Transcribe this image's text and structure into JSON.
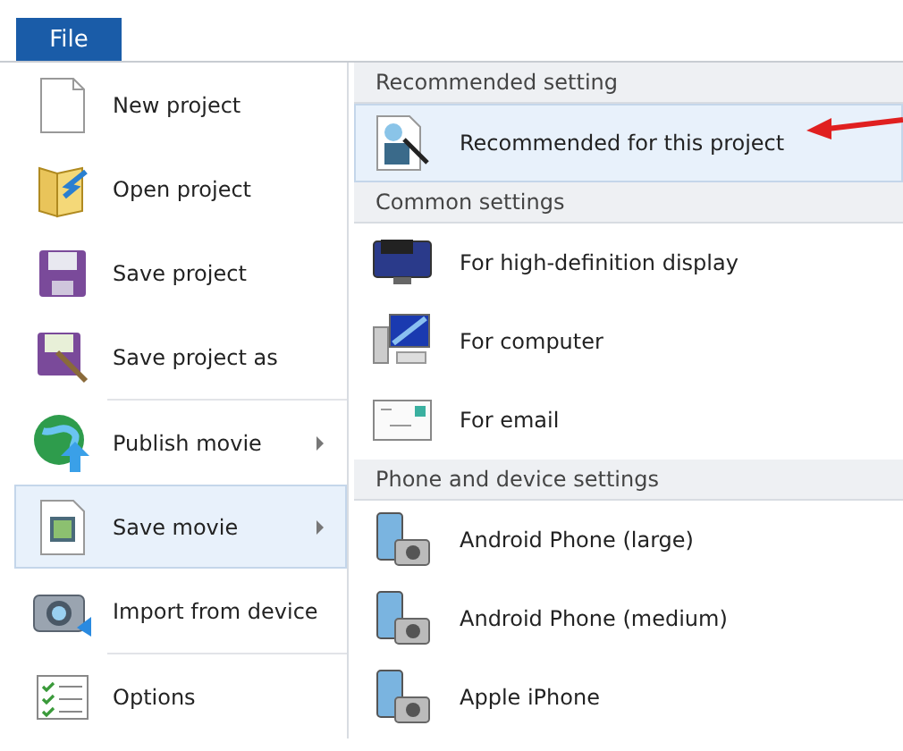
{
  "tab": {
    "label": "File",
    "selected": true
  },
  "menu_groups": [
    {
      "items": [
        {
          "label": "New project",
          "selected": false,
          "has_submenu": false
        },
        {
          "label": "Open project",
          "selected": false,
          "has_submenu": false
        },
        {
          "label": "Save project",
          "selected": false,
          "has_submenu": false
        },
        {
          "label": "Save project as",
          "selected": false,
          "has_submenu": false
        }
      ]
    },
    {
      "items": [
        {
          "label": "Publish movie",
          "selected": false,
          "has_submenu": true
        },
        {
          "label": "Save movie",
          "selected": true,
          "has_submenu": true
        },
        {
          "label": "Import from device",
          "selected": false,
          "has_submenu": false
        }
      ]
    },
    {
      "items": [
        {
          "label": "Options",
          "selected": false,
          "has_submenu": false
        }
      ]
    }
  ],
  "submenu_sections": [
    {
      "header": "Recommended setting",
      "items": [
        {
          "label": "Recommended for this project",
          "selected": true
        }
      ]
    },
    {
      "header": "Common settings",
      "items": [
        {
          "label": "For high-definition display",
          "selected": false
        },
        {
          "label": "For computer",
          "selected": false
        },
        {
          "label": "For email",
          "selected": false
        }
      ]
    },
    {
      "header": "Phone and device settings",
      "items": [
        {
          "label": "Android Phone (large)",
          "selected": false
        },
        {
          "label": "Android Phone (medium)",
          "selected": false
        },
        {
          "label": "Apple iPhone",
          "selected": false
        }
      ]
    }
  ]
}
